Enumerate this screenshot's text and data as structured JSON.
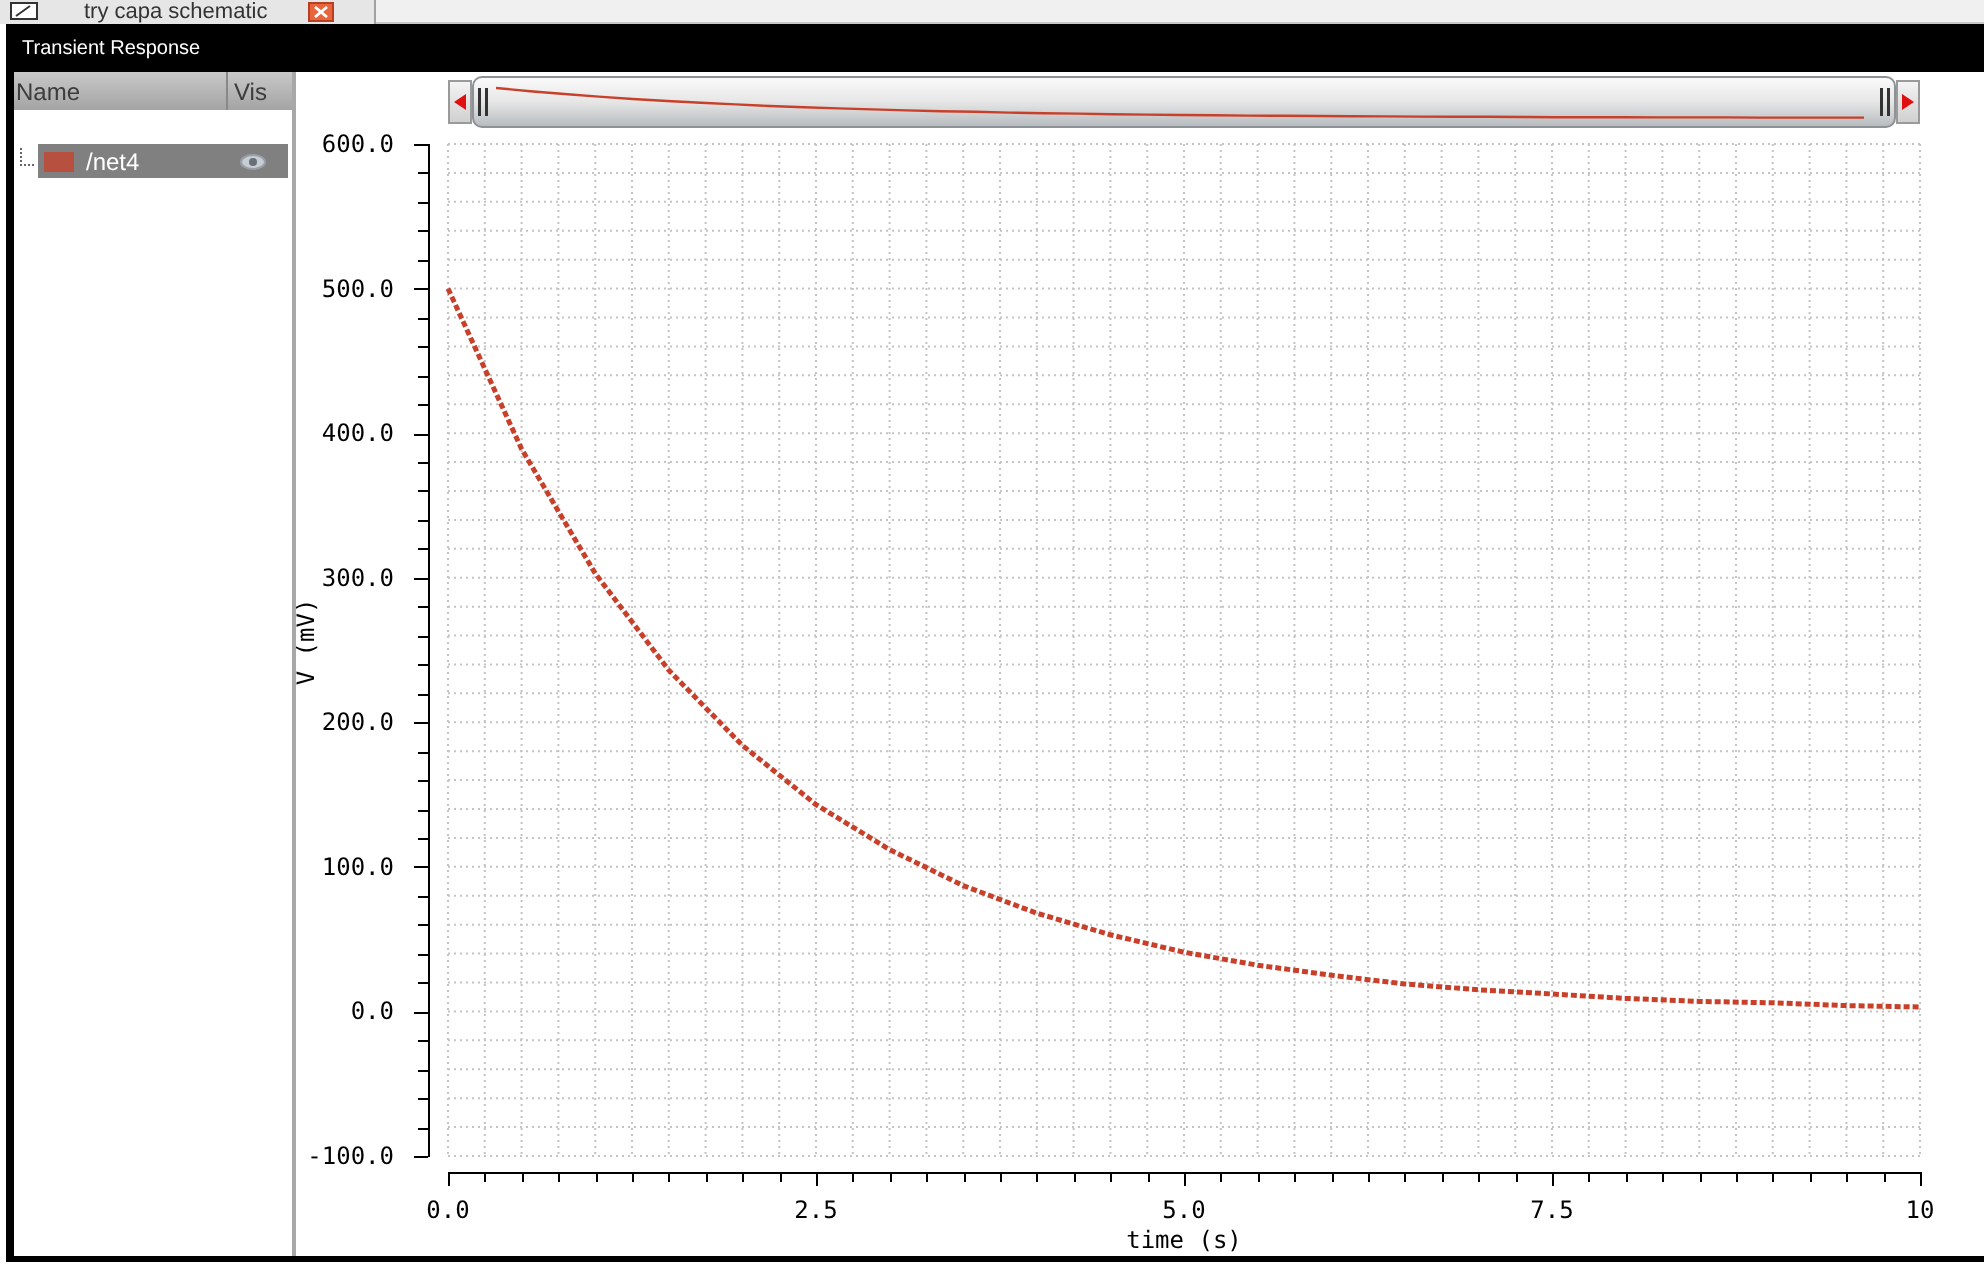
{
  "tab": {
    "title": "try capa schematic"
  },
  "window": {
    "title": "Transient Response"
  },
  "signal_list": {
    "columns": [
      "Name",
      "Vis"
    ],
    "items": [
      {
        "name": "/net4",
        "color": "#b85040",
        "selected": true,
        "visible": true
      }
    ]
  },
  "plot": {
    "chart_data": {
      "type": "line",
      "xlabel": "time (s)",
      "ylabel": "V (mV)",
      "grid": true,
      "x": [
        0,
        0.5,
        1,
        1.5,
        2,
        2.5,
        3,
        3.5,
        4,
        4.5,
        5,
        5.5,
        6,
        6.5,
        7,
        7.5,
        8,
        8.5,
        9,
        9.5,
        10
      ],
      "series": [
        {
          "color": "#c8402a",
          "line_style": "dashed",
          "values": [
            500,
            389,
            303,
            236,
            184,
            143,
            112,
            87,
            68,
            53,
            41,
            32,
            25,
            19,
            15,
            12,
            9,
            7,
            6,
            4,
            3
          ]
        }
      ],
      "xlim": [
        0,
        10
      ],
      "ylim": [
        -100,
        600
      ],
      "xticks": [
        {
          "value": 0,
          "label": "0.0"
        },
        {
          "value": 2.5,
          "label": "2.5"
        },
        {
          "value": 5,
          "label": "5.0"
        },
        {
          "value": 7.5,
          "label": "7.5"
        },
        {
          "value": 10,
          "label": "10"
        }
      ],
      "yticks": [
        {
          "value": -100,
          "label": "-100.0"
        },
        {
          "value": 0,
          "label": "0.0"
        },
        {
          "value": 100,
          "label": "100.0"
        },
        {
          "value": 200,
          "label": "200.0"
        },
        {
          "value": 300,
          "label": "300.0"
        },
        {
          "value": 400,
          "label": "400.0"
        },
        {
          "value": 500,
          "label": "500.0"
        },
        {
          "value": 600,
          "label": "600.0"
        }
      ]
    }
  }
}
